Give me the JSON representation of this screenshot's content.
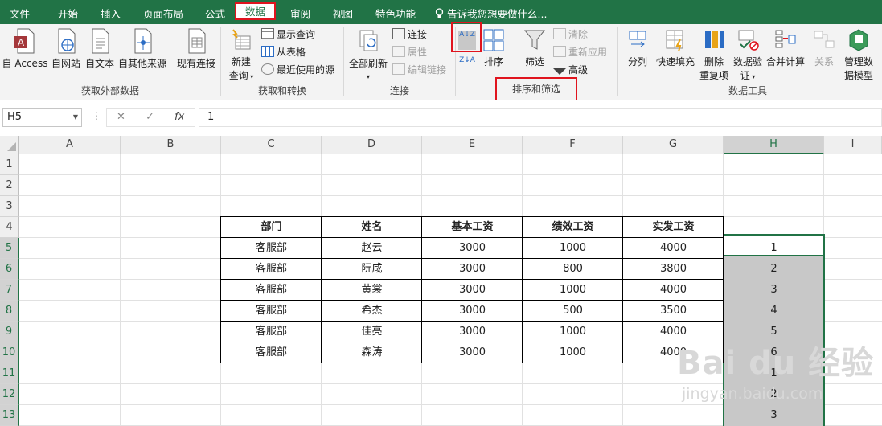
{
  "menu": {
    "items": [
      "文件",
      "开始",
      "插入",
      "页面布局",
      "公式",
      "数据",
      "审阅",
      "视图",
      "特色功能"
    ],
    "active": "数据",
    "tell_me": "告诉我您想要做什么..."
  },
  "ribbon": {
    "external": {
      "buttons": [
        "自 Access",
        "自网站",
        "自文本",
        "自其他来源",
        "现有连接"
      ],
      "group": "获取外部数据"
    },
    "transform": {
      "new_query": [
        "新建",
        "查询"
      ],
      "small": [
        "显示查询",
        "从表格",
        "最近使用的源"
      ],
      "group": "获取和转换"
    },
    "connections": {
      "refresh_all": "全部刷新",
      "small": [
        "连接",
        "属性",
        "编辑链接"
      ],
      "group": "连接"
    },
    "sort_filter": {
      "az": "A↓Z",
      "za": "Z↓A",
      "sort": "排序",
      "filter": "筛选",
      "small": [
        "清除",
        "重新应用",
        "高级"
      ],
      "group": "排序和筛选"
    },
    "data_tools": {
      "buttons": [
        "分列",
        "快速填充",
        [
          "删除",
          "重复项"
        ],
        [
          "数据验",
          "证"
        ],
        "合并计算",
        "关系",
        [
          "管理数",
          "据模型"
        ]
      ],
      "group": "数据工具"
    }
  },
  "formula_bar": {
    "name_box": "H5",
    "cancel": "✕",
    "enter": "✓",
    "fx": "fx",
    "value": "1"
  },
  "columns": [
    "A",
    "B",
    "C",
    "D",
    "E",
    "F",
    "G",
    "H",
    "I"
  ],
  "selected_column": "H",
  "rows": [
    "1",
    "2",
    "3",
    "4",
    "5",
    "6",
    "7",
    "8",
    "9",
    "10",
    "11",
    "12",
    "13"
  ],
  "table": {
    "headers": [
      "部门",
      "姓名",
      "基本工资",
      "绩效工资",
      "实发工资"
    ],
    "rows": [
      [
        "客服部",
        "赵云",
        "3000",
        "1000",
        "4000"
      ],
      [
        "客服部",
        "阮咸",
        "3000",
        "800",
        "3800"
      ],
      [
        "客服部",
        "黄裳",
        "3000",
        "1000",
        "4000"
      ],
      [
        "客服部",
        "希杰",
        "3000",
        "500",
        "3500"
      ],
      [
        "客服部",
        "佳亮",
        "3000",
        "1000",
        "4000"
      ],
      [
        "客服部",
        "森涛",
        "3000",
        "1000",
        "4000"
      ]
    ]
  },
  "column_h": [
    "1",
    "2",
    "3",
    "4",
    "5",
    "6",
    "1",
    "2",
    "3"
  ],
  "watermark": {
    "brand": "Bai du 经验",
    "url": "jingyan.baidu.com"
  },
  "colors": {
    "excel_green": "#217346",
    "highlight_red": "#e0141e",
    "selection_gray": "#c8c8c8"
  }
}
